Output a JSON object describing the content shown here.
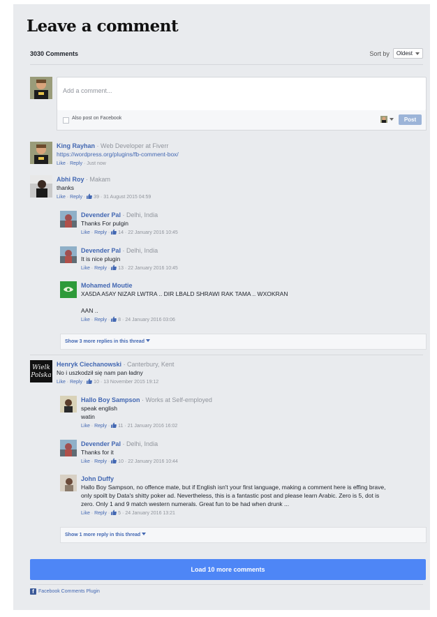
{
  "header": {
    "title": "Leave a comment",
    "count_label": "3030 Comments",
    "sort_label": "Sort by",
    "sort_value": "Oldest"
  },
  "composer": {
    "placeholder": "Add a comment...",
    "also_post": "Also post on Facebook",
    "post_label": "Post"
  },
  "comments": [
    {
      "name": "King Rayhan",
      "role": "· Web Developer at Fiverr",
      "text": "https://wordpress.org/plugins/fb-comment-box/",
      "like": "Like",
      "reply": "Reply",
      "likes": "",
      "time": "Just now"
    },
    {
      "name": "Abhi Roy",
      "role": "· Makam",
      "text": "thanks",
      "like": "Like",
      "reply": "Reply",
      "likes": "39",
      "time": "31 August 2015 04:59",
      "replies": [
        {
          "name": "Devender Pal",
          "role": "· Delhi, India",
          "text": "Thanks For pulgin",
          "likes": "14",
          "time": "22 January 2016 10:45"
        },
        {
          "name": "Devender Pal",
          "role": "· Delhi, India",
          "text": "It is nice plugin",
          "likes": "13",
          "time": "22 January 2016 10:45"
        },
        {
          "name": "Mohamed Moutie",
          "role": "",
          "text_lines": [
            "XA5DA A5AY NIZAR LWTRA .. DIR LBALD SHRAWI RAK TAMA .. WXOKRAN",
            "",
            "AAN .."
          ],
          "likes": "8",
          "time": "24 January 2016 03:06"
        }
      ],
      "more_replies": "Show 3 more replies in this thread"
    },
    {
      "name": "Henryk Ciechanowski",
      "role": "· Canterbury, Kent",
      "text": "No i uszkodził się nam pan ładny",
      "like": "Like",
      "reply": "Reply",
      "likes": "10",
      "time": "13 November 2015 19:12",
      "replies": [
        {
          "name": "Hallo Boy Sampson",
          "role": "· Works at Self-employed",
          "text_lines": [
            "speak english",
            "watin"
          ],
          "likes": "11",
          "time": "21 January 2016 16:02"
        },
        {
          "name": "Devender Pal",
          "role": "· Delhi, India",
          "text": "Thanks for it",
          "likes": "10",
          "time": "22 January 2016 10:44"
        },
        {
          "name": "John Duffy",
          "role": "",
          "text_lines": [
            "Hallo Boy Sampson, no offence mate, but if English isn't your first language, making a comment here is effing brave,",
            "only spoilt by Data's shitty poker ad. Nevertheless, this is a fantastic post and please learn Arabic. Zero is 5, dot is",
            "zero. Only 1 and 9 match western numerals. Great fun to be had when drunk ..."
          ],
          "likes": "5",
          "time": "24 January 2016 13:21"
        }
      ],
      "more_replies": "Show 1 more reply in this thread"
    }
  ],
  "load_more": "Load 10 more comments",
  "footer": "Facebook Comments Plugin",
  "avatar_texts": {
    "henryk_line1": "Wielk",
    "henryk_line2": "Polska"
  },
  "colors": {
    "accent": "#4267b2",
    "button": "#4e86f6",
    "panel": "#e9ebee",
    "post_disabled": "#9cb4d8"
  }
}
